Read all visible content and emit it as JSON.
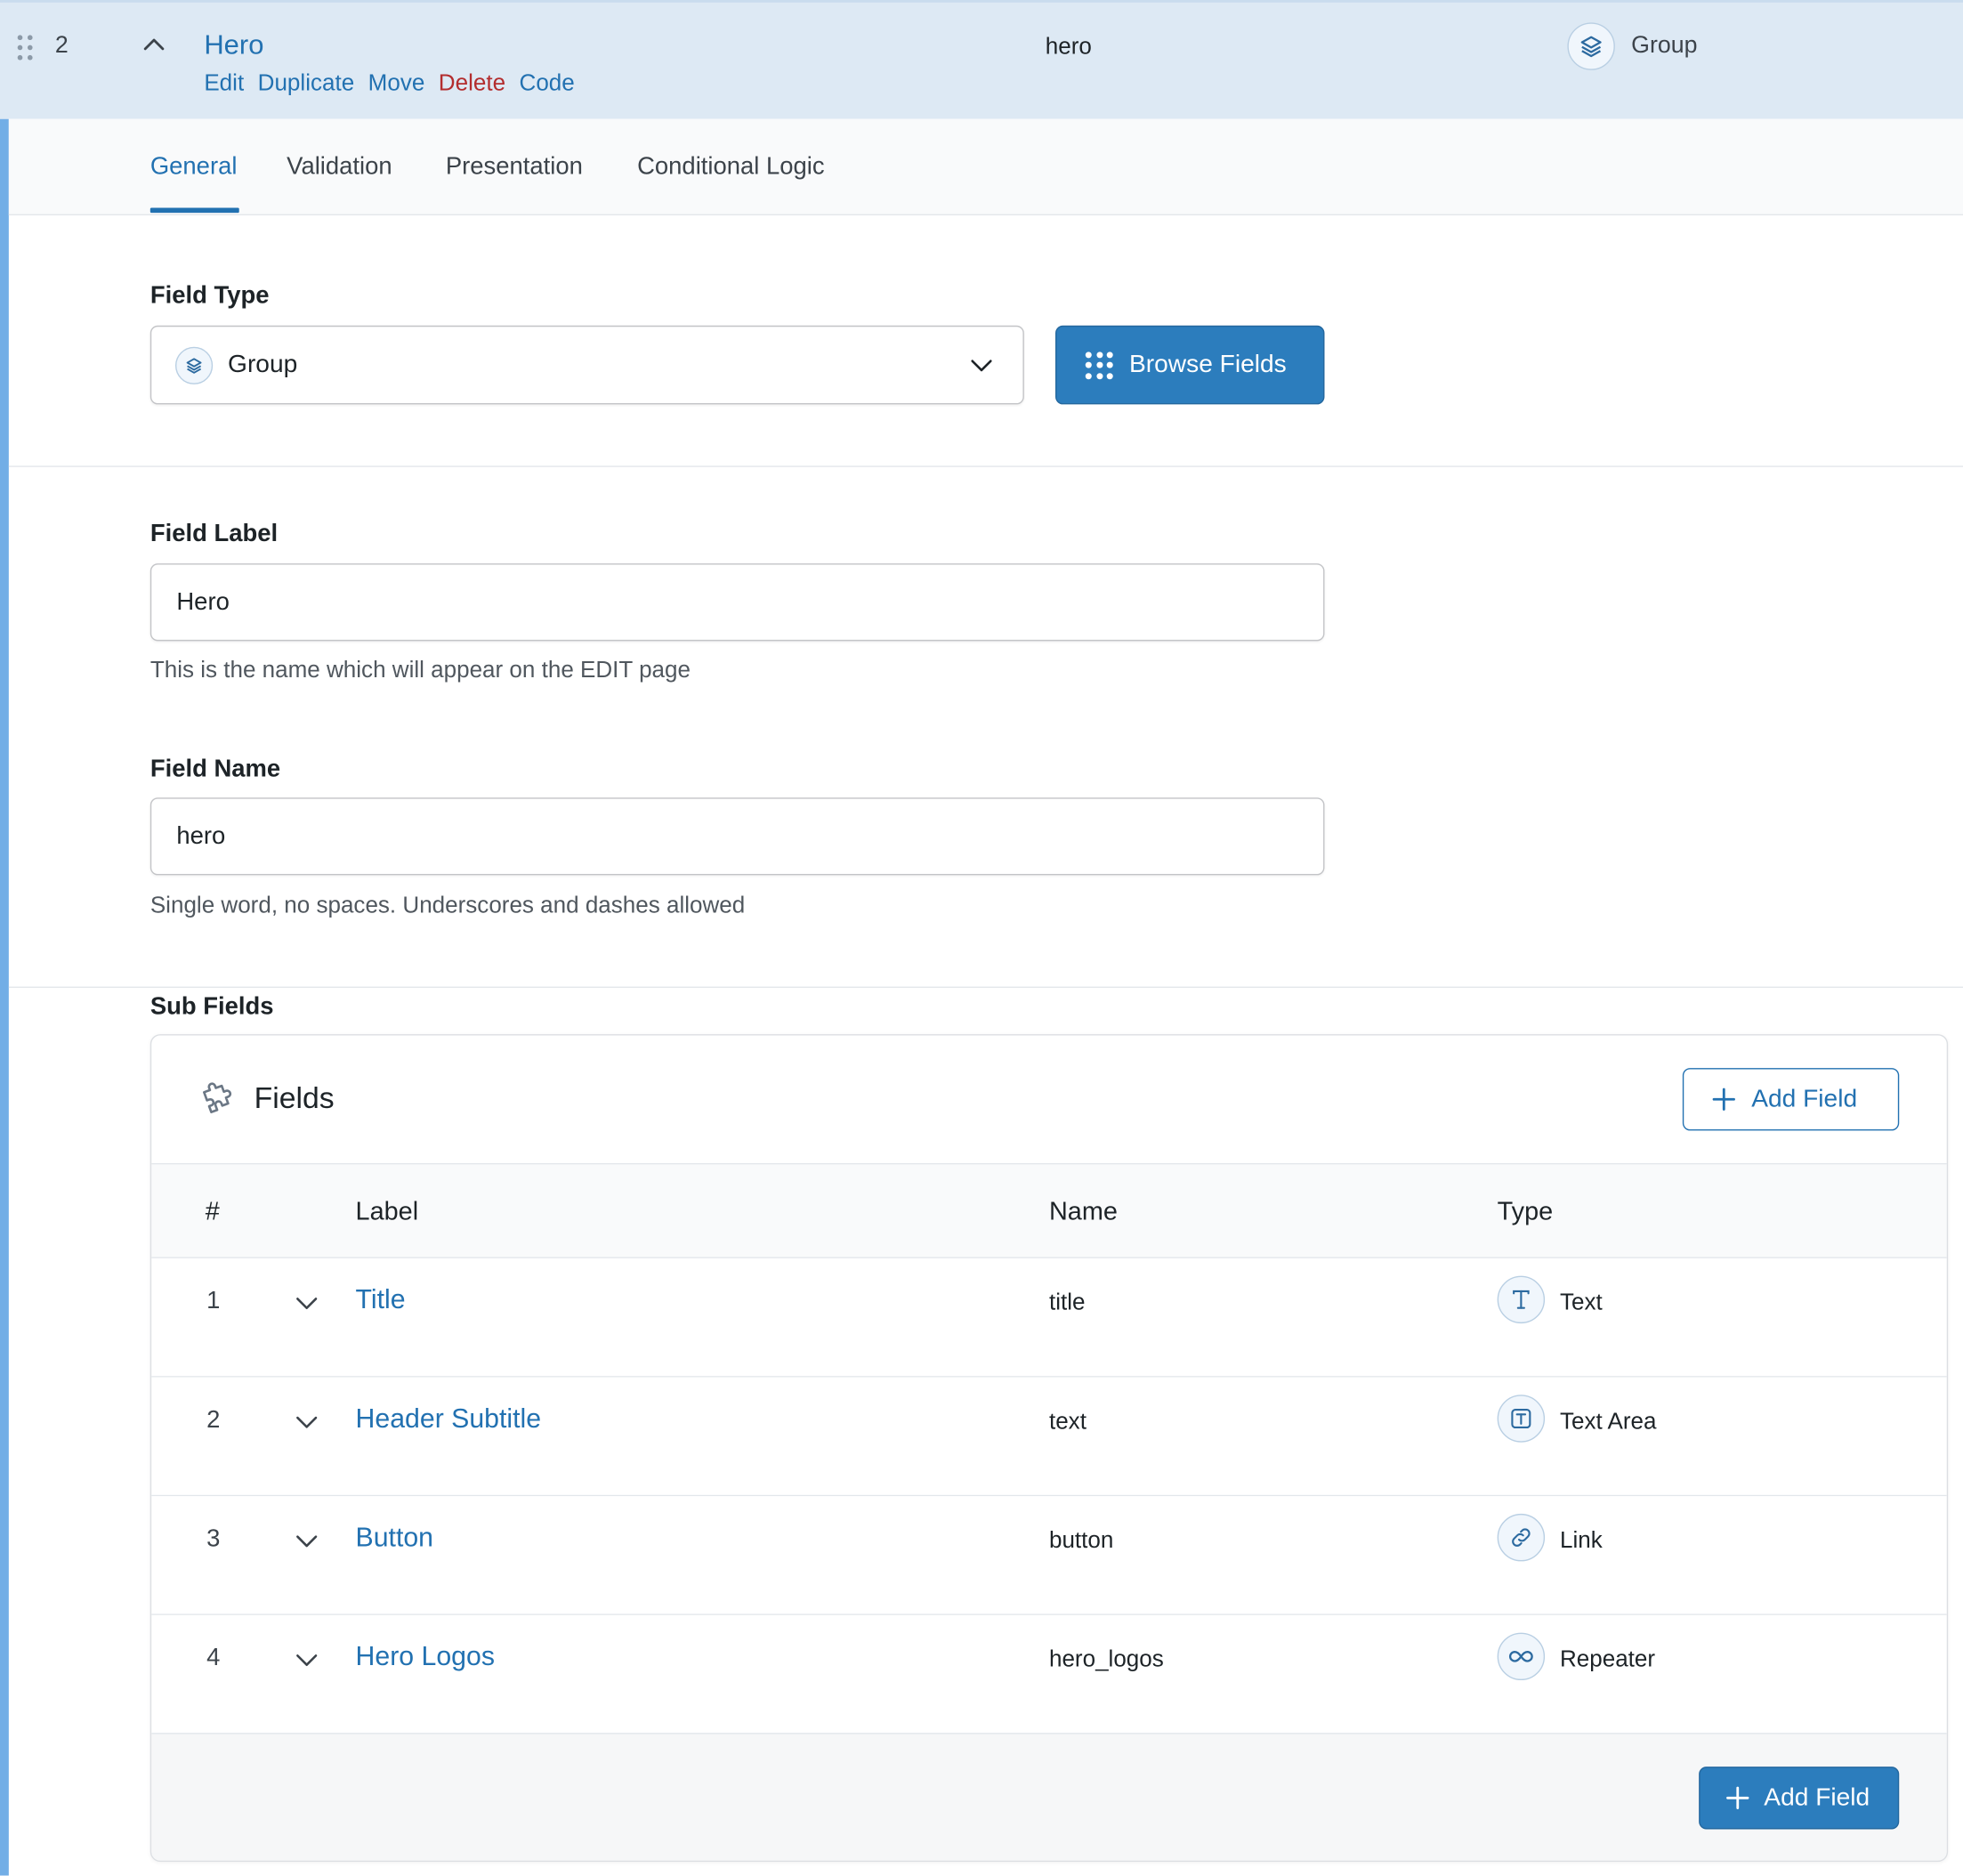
{
  "header": {
    "order": "2",
    "label": "Hero",
    "actions": {
      "edit": "Edit",
      "duplicate": "Duplicate",
      "move": "Move",
      "delete": "Delete",
      "code": "Code"
    },
    "name": "hero",
    "type": "Group",
    "type_icon": "layers-icon"
  },
  "tabs": [
    {
      "label": "General",
      "active": true
    },
    {
      "label": "Validation",
      "active": false
    },
    {
      "label": "Presentation",
      "active": false
    },
    {
      "label": "Conditional Logic",
      "active": false
    }
  ],
  "field_type": {
    "label": "Field Type",
    "value": "Group",
    "browse_button": "Browse Fields"
  },
  "field_label": {
    "label": "Field Label",
    "value": "Hero",
    "instructions": "This is the name which will appear on the EDIT page"
  },
  "field_name": {
    "label": "Field Name",
    "value": "hero",
    "instructions": "Single word, no spaces. Underscores and dashes allowed"
  },
  "sub_fields": {
    "label": "Sub Fields",
    "panel_title": "Fields",
    "add_field_top": "Add Field",
    "add_field_bottom": "Add Field",
    "columns": {
      "order": "#",
      "label": "Label",
      "name": "Name",
      "type": "Type"
    },
    "rows": [
      {
        "order": "1",
        "label": "Title",
        "name": "title",
        "type": "Text",
        "icon": "text-t-icon"
      },
      {
        "order": "2",
        "label": "Header Subtitle",
        "name": "text",
        "type": "Text Area",
        "icon": "textarea-icon"
      },
      {
        "order": "3",
        "label": "Button",
        "name": "button",
        "type": "Link",
        "icon": "link-icon"
      },
      {
        "order": "4",
        "label": "Hero Logos",
        "name": "hero_logos",
        "type": "Repeater",
        "icon": "infinity-icon"
      }
    ]
  },
  "colors": {
    "accent": "#2271b1",
    "danger": "#b32d2e",
    "header_bg": "#dde9f4",
    "primary_button": "#2c7dbd"
  }
}
